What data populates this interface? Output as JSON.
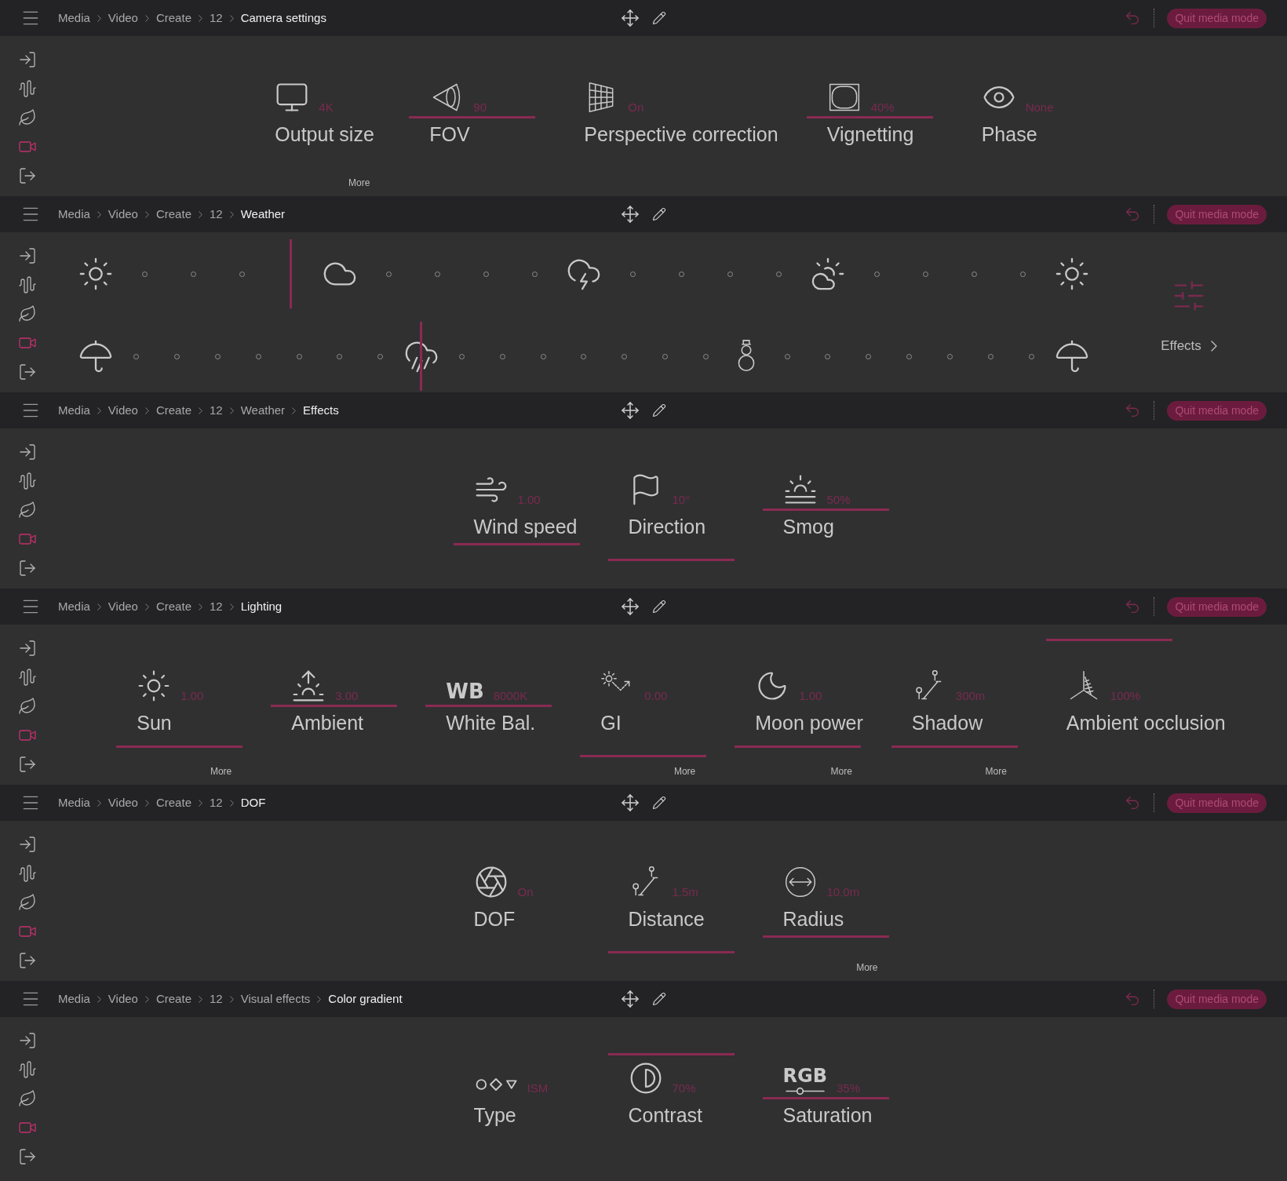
{
  "panels": [
    {
      "breadcrumbs": [
        "Media",
        "Video",
        "Create",
        "12",
        "Camera settings"
      ],
      "quit": "Quit media mode",
      "sidebar": [
        {
          "kind": "login",
          "selected": false
        },
        {
          "kind": "wave",
          "selected": false
        },
        {
          "kind": "leaf",
          "selected": false
        },
        {
          "kind": "video",
          "selected": true
        },
        {
          "kind": "logout",
          "selected": false
        }
      ],
      "content": {
        "kind": "controls",
        "controls": [
          {
            "kind": "monitor",
            "value": "4K",
            "label": "Output size",
            "bar": false,
            "more": "More"
          },
          {
            "kind": "fov",
            "value": "90",
            "label": "FOV",
            "bar": true
          },
          {
            "kind": "grid",
            "value": "On",
            "label": "Perspective correction",
            "bar": false
          },
          {
            "kind": "vignette",
            "value": "40%",
            "label": "Vignetting",
            "bar": true
          },
          {
            "kind": "eye",
            "value": "None",
            "label": "Phase",
            "bar": false
          }
        ]
      }
    },
    {
      "breadcrumbs": [
        "Media",
        "Video",
        "Create",
        "12",
        "Weather"
      ],
      "quit": "Quit media mode",
      "sidebar": [
        {
          "kind": "login",
          "selected": false
        },
        {
          "kind": "wave",
          "selected": false
        },
        {
          "kind": "leaf",
          "selected": false
        },
        {
          "kind": "video",
          "selected": true
        },
        {
          "kind": "logout",
          "selected": false
        }
      ],
      "content": {
        "kind": "weather",
        "effects": "Effects",
        "rows": [
          {
            "steps": [
              {
                "kind": "sun",
                "selected": false
              },
              {
                "kind": "dot",
                "selected": false
              },
              {
                "kind": "dot",
                "selected": false
              },
              {
                "kind": "dot",
                "selected": false
              },
              {
                "kind": "dot",
                "selected": true
              },
              {
                "kind": "cloud",
                "selected": false
              },
              {
                "kind": "dot",
                "selected": false
              },
              {
                "kind": "dot",
                "selected": false
              },
              {
                "kind": "dot",
                "selected": false
              },
              {
                "kind": "dot",
                "selected": false
              },
              {
                "kind": "storm",
                "selected": false
              },
              {
                "kind": "dot",
                "selected": false
              },
              {
                "kind": "dot",
                "selected": false
              },
              {
                "kind": "dot",
                "selected": false
              },
              {
                "kind": "dot",
                "selected": false
              },
              {
                "kind": "suncloud",
                "selected": false
              },
              {
                "kind": "dot",
                "selected": false
              },
              {
                "kind": "dot",
                "selected": false
              },
              {
                "kind": "dot",
                "selected": false
              },
              {
                "kind": "dot",
                "selected": false
              },
              {
                "kind": "sun",
                "selected": false
              }
            ]
          },
          {
            "steps": [
              {
                "kind": "umbrella",
                "selected": false
              },
              {
                "kind": "dot",
                "selected": false
              },
              {
                "kind": "dot",
                "selected": false
              },
              {
                "kind": "dot",
                "selected": false
              },
              {
                "kind": "dot",
                "selected": false
              },
              {
                "kind": "dot",
                "selected": false
              },
              {
                "kind": "dot",
                "selected": false
              },
              {
                "kind": "dot",
                "selected": false
              },
              {
                "kind": "windrain",
                "selected": true
              },
              {
                "kind": "dot",
                "selected": false
              },
              {
                "kind": "dot",
                "selected": false
              },
              {
                "kind": "dot",
                "selected": false
              },
              {
                "kind": "dot",
                "selected": false
              },
              {
                "kind": "dot",
                "selected": false
              },
              {
                "kind": "dot",
                "selected": false
              },
              {
                "kind": "dot",
                "selected": false
              },
              {
                "kind": "snowman",
                "selected": false
              },
              {
                "kind": "dot",
                "selected": false
              },
              {
                "kind": "dot",
                "selected": false
              },
              {
                "kind": "dot",
                "selected": false
              },
              {
                "kind": "dot",
                "selected": false
              },
              {
                "kind": "dot",
                "selected": false
              },
              {
                "kind": "dot",
                "selected": false
              },
              {
                "kind": "dot",
                "selected": false
              },
              {
                "kind": "umbrella",
                "selected": false
              }
            ]
          }
        ]
      }
    },
    {
      "breadcrumbs": [
        "Media",
        "Video",
        "Create",
        "12",
        "Weather",
        "Effects"
      ],
      "quit": "Quit media mode",
      "sidebar": [
        {
          "kind": "login",
          "selected": false
        },
        {
          "kind": "wave",
          "selected": false
        },
        {
          "kind": "leaf",
          "selected": false
        },
        {
          "kind": "video",
          "selected": true
        },
        {
          "kind": "logout",
          "selected": false
        }
      ],
      "content": {
        "kind": "controls",
        "controls": [
          {
            "kind": "wind",
            "value": "1.00",
            "label": "Wind speed",
            "bar": true
          },
          {
            "kind": "windsock",
            "value": "10°",
            "label": "Direction",
            "bar": true
          },
          {
            "kind": "smog",
            "value": "50%",
            "label": "Smog",
            "bar": true
          }
        ]
      }
    },
    {
      "breadcrumbs": [
        "Media",
        "Video",
        "Create",
        "12",
        "Lighting"
      ],
      "quit": "Quit media mode",
      "sidebar": [
        {
          "kind": "login",
          "selected": false
        },
        {
          "kind": "wave",
          "selected": false
        },
        {
          "kind": "leaf",
          "selected": false
        },
        {
          "kind": "video",
          "selected": true
        },
        {
          "kind": "logout",
          "selected": false
        }
      ],
      "content": {
        "kind": "controls",
        "controls": [
          {
            "kind": "sun",
            "value": "1.00",
            "label": "Sun",
            "bar": true,
            "more": "More"
          },
          {
            "kind": "ambient",
            "value": "3.00",
            "label": "Ambient",
            "bar": true
          },
          {
            "kind": "letters",
            "letters": "WB",
            "value": "8000K",
            "label": "White Bal.",
            "bar": true
          },
          {
            "kind": "gi",
            "value": "0.00",
            "label": "GI",
            "bar": true,
            "more": "More"
          },
          {
            "kind": "moon",
            "value": "1.00",
            "label": "Moon power",
            "bar": true,
            "more": "More"
          },
          {
            "kind": "pins",
            "value": "300m",
            "label": "Shadow",
            "bar": true,
            "more": "More"
          },
          {
            "kind": "ao",
            "value": "100%",
            "label": "Ambient occlusion",
            "bar": true
          }
        ]
      }
    },
    {
      "breadcrumbs": [
        "Media",
        "Video",
        "Create",
        "12",
        "DOF"
      ],
      "quit": "Quit media mode",
      "sidebar": [
        {
          "kind": "login",
          "selected": false
        },
        {
          "kind": "wave",
          "selected": false
        },
        {
          "kind": "leaf",
          "selected": false
        },
        {
          "kind": "video",
          "selected": true
        },
        {
          "kind": "logout",
          "selected": false
        }
      ],
      "content": {
        "kind": "controls",
        "controls": [
          {
            "kind": "aperture",
            "value": "On",
            "label": "DOF",
            "bar": false
          },
          {
            "kind": "pins",
            "value": "1.5m",
            "label": "Distance",
            "bar": true
          },
          {
            "kind": "radius",
            "value": "10.0m",
            "label": "Radius",
            "bar": true,
            "more": "More"
          }
        ]
      }
    },
    {
      "breadcrumbs": [
        "Media",
        "Video",
        "Create",
        "12",
        "Visual effects",
        "Color gradient"
      ],
      "quit": "Quit media mode",
      "sidebar": [
        {
          "kind": "login",
          "selected": false
        },
        {
          "kind": "wave",
          "selected": false
        },
        {
          "kind": "leaf",
          "selected": false
        },
        {
          "kind": "video",
          "selected": true
        },
        {
          "kind": "logout",
          "selected": false
        }
      ],
      "content": {
        "kind": "controls",
        "controls": [
          {
            "kind": "shapes",
            "value": "ISM",
            "label": "Type",
            "bar": false
          },
          {
            "kind": "contrast",
            "value": "70%",
            "label": "Contrast",
            "bar": true
          },
          {
            "kind": "rgb",
            "letters": "RGB",
            "value": "35%",
            "label": "Saturation",
            "bar": true
          }
        ]
      }
    }
  ]
}
